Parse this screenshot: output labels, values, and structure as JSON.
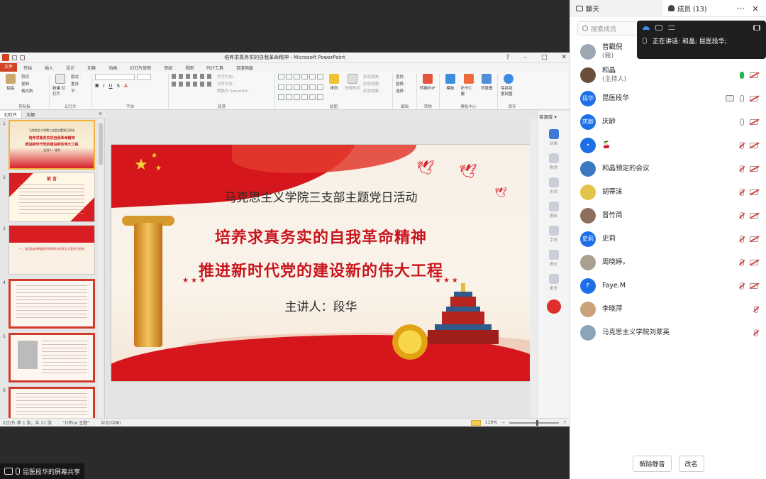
{
  "ppt": {
    "window_title": "培养求真务实的自我革命精神 - Microsoft PowerPoint",
    "tabs": [
      "文件",
      "开始",
      "插入",
      "设计",
      "切换",
      "动画",
      "幻灯片放映",
      "审阅",
      "视图",
      "PDF工具",
      "百度网盘"
    ],
    "groups": {
      "clipboard": {
        "label": "剪贴板",
        "paste": "粘贴",
        "cut": "剪切",
        "copy": "复制 ·",
        "format": "格式刷"
      },
      "slides": {
        "label": "幻灯片",
        "new": "新建\n幻灯片",
        "layout": "版式 ·",
        "reset": "重设",
        "section": "节 ·"
      },
      "font": {
        "label": "字体"
      },
      "paragraph": {
        "label": "段落",
        "text_dir": "文字方向 ·",
        "align": "对齐文本 ·",
        "smartart": "转换为 SmartArt ·"
      },
      "drawing": {
        "label": "绘图",
        "arrange": "排列",
        "quick_styles": "快速样式",
        "fill": "形状填充 ·",
        "outline": "形状轮廓 ·",
        "effects": "形状效果 ·"
      },
      "edit": {
        "label": "编辑",
        "find": "查找",
        "replace": "替换 ·",
        "select": "选择 ·"
      },
      "convert": {
        "label": "转换",
        "topdf": "转换PDF"
      },
      "template": {
        "label": "模板中心",
        "template": "模板",
        "cmd": "命令汇报",
        "bg": "背景图"
      },
      "save": {
        "label": "保存",
        "savenet": "保存到\n度网盘"
      }
    },
    "panel_tabs": {
      "slides": "幻灯片",
      "outline": "大纲",
      "close": "×"
    },
    "thumbnails": [
      {
        "num": "1",
        "title": "马克思主义学院三支部主题党日活动",
        "line1": "培养求真务实的自我革命精神",
        "line2": "推进新时代党的建设新的伟大工程",
        "line3": "主讲人：段华"
      },
      {
        "num": "2",
        "title": "前 言"
      },
      {
        "num": "3",
        "title": "一、党员务必增强进步的同时与形式主义宣传大前进"
      },
      {
        "num": "4"
      },
      {
        "num": "5"
      },
      {
        "num": "6"
      }
    ],
    "slide": {
      "subtitle": "马克思主义学院三支部主题党日活动",
      "line1": "培养求真务实的自我革命精神",
      "line2": "推进新时代党的建设新的伟大工程",
      "presenter": "主讲人：段华"
    },
    "assistant": {
      "header": "资源库 ▾",
      "items": [
        "动画",
        "教师",
        "形状",
        "图标",
        "字符",
        "图示",
        "更多"
      ]
    },
    "status": {
      "slide_info": "幻灯片 第 1 张，共 21 张",
      "theme": "\"Office 主题\"",
      "lang": "中文(中国)",
      "zoom": "119%"
    }
  },
  "share_bar": {
    "label": "昆医段华的屏幕共享"
  },
  "meeting": {
    "chat_tab": "聊天",
    "members_tab": "成员 (13)",
    "more": "···",
    "close": "×",
    "search_placeholder": "搜索成员",
    "speaking_label": "正在讲话: 和晶; 昆医段华;",
    "members": [
      {
        "name": "普戳倪",
        "tag": "(我)",
        "avatar_text": "",
        "avatar_color": "#9fa7b3",
        "mic": "none",
        "cam": "none"
      },
      {
        "name": "和晶",
        "tag": "(主持人)",
        "avatar_text": "",
        "avatar_color": "#6b4f3a",
        "mic": "on",
        "cam": "off"
      },
      {
        "name": "昆医段华",
        "tag": "",
        "avatar_text": "段华",
        "avatar_color": "#1d6fe8",
        "mic": "normal",
        "cam": "off",
        "share": true
      },
      {
        "name": "庆龄",
        "tag": "",
        "avatar_text": "庆龄",
        "avatar_color": "#1d6fe8",
        "mic": "normal",
        "cam": "off"
      },
      {
        "name": "🍒",
        "tag": "",
        "avatar_text": "•",
        "avatar_color": "#1d6fe8",
        "mic": "muted",
        "cam": "off"
      },
      {
        "name": "和晶预定的会议",
        "tag": "",
        "avatar_text": "",
        "avatar_color": "#3a78c2",
        "mic": "muted",
        "cam": "off"
      },
      {
        "name": "胡蒂沫",
        "tag": "",
        "avatar_text": "",
        "avatar_color": "#e3c34a",
        "mic": "muted",
        "cam": "off"
      },
      {
        "name": "晋竹茼",
        "tag": "",
        "avatar_text": "",
        "avatar_color": "#8e6f5e",
        "mic": "muted",
        "cam": "off"
      },
      {
        "name": "史莉",
        "tag": "",
        "avatar_text": "史莉",
        "avatar_color": "#1d6fe8",
        "mic": "muted",
        "cam": "off"
      },
      {
        "name": "周晓婷。",
        "tag": "",
        "avatar_text": "",
        "avatar_color": "#a9a08f",
        "mic": "muted",
        "cam": "off"
      },
      {
        "name": "Faye.M",
        "tag": "",
        "avatar_text": "F",
        "avatar_color": "#1d6fe8",
        "mic": "muted",
        "cam": "off"
      },
      {
        "name": "李晓萍",
        "tag": "",
        "avatar_text": "",
        "avatar_color": "#caa27a",
        "mic": "muted",
        "cam": "none"
      },
      {
        "name": "马克思主义学院刘翠英",
        "tag": "",
        "avatar_text": "",
        "avatar_color": "#8ba4b8",
        "mic": "muted",
        "cam": "none"
      }
    ],
    "unmute_button": "解除静音",
    "rename_button": "改名"
  }
}
